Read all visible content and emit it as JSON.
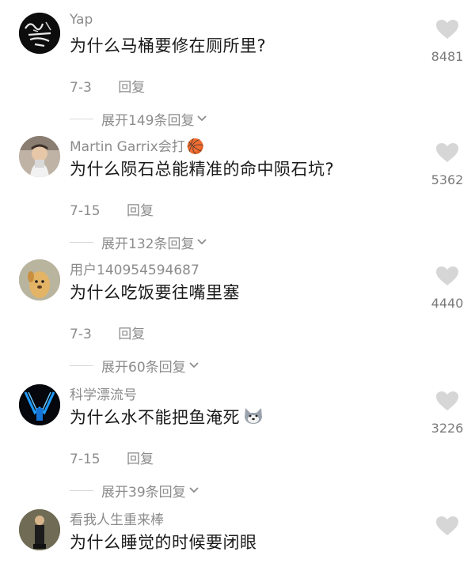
{
  "comments": [
    {
      "username": "Yap",
      "text": "为什么马桶要修在厕所里?",
      "date": "7-3",
      "reply": "回复",
      "expand": "展开149条回复",
      "likes": "8481",
      "avatar_icon": "dark-graffiti-avatar"
    },
    {
      "username": "Martin Garrix会打",
      "emoji": "🏀",
      "text": "为什么陨石总能精准的命中陨石坑?",
      "date": "7-15",
      "reply": "回复",
      "expand": "展开132条回复",
      "likes": "5362",
      "avatar_icon": "person-photo-avatar"
    },
    {
      "username": "用户140954594687",
      "text": "为什么吃饭要往嘴里塞",
      "date": "7-3",
      "reply": "回复",
      "expand": "展开60条回复",
      "likes": "4440",
      "avatar_icon": "cartoon-dog-avatar"
    },
    {
      "username": "科学漂流号",
      "text": "为什么水不能把鱼淹死",
      "date": "7-15",
      "reply": "回复",
      "expand": "展开39条回复",
      "likes": "3226",
      "avatar_icon": "blue-neon-logo-avatar",
      "trailing_icon": "doge-emoji"
    },
    {
      "username": "看我人生重来棒",
      "text": "为什么睡觉的时候要闭眼",
      "avatar_icon": "standing-person-avatar"
    }
  ],
  "colors": {
    "text": "#1a1a1a",
    "muted": "#8c8c8c",
    "heart": "#d0d0d0"
  }
}
